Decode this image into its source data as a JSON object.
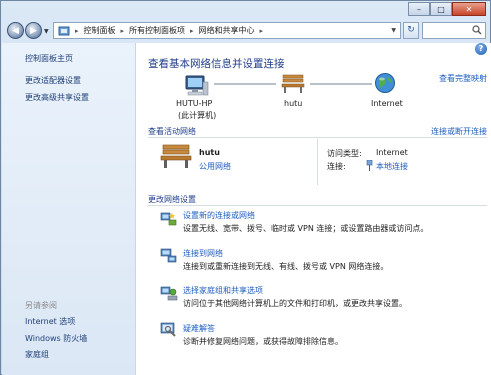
{
  "address_bar": {
    "crumbs": [
      "控制面板",
      "所有控制面板项",
      "网络和共享中心"
    ]
  },
  "window_controls": {
    "minimize": "–",
    "maximize": "□",
    "close": "✕"
  },
  "sidebar": {
    "home": "控制面板主页",
    "links": [
      "更改适配器设置",
      "更改高级共享设置"
    ],
    "see_also_label": "另请参阅",
    "see_also": [
      "Internet 选项",
      "Windows 防火墙",
      "家庭组"
    ]
  },
  "main": {
    "title": "查看基本网络信息并设置连接",
    "view_full_map": "查看完整映射",
    "map": {
      "computer_name": "HUTU-HP",
      "computer_sub": "(此计算机)",
      "network_name": "hutu",
      "internet_label": "Internet"
    },
    "active_label": "查看活动网络",
    "connect_disconnect": "连接或断开连接",
    "active_network": {
      "name": "hutu",
      "type": "公用网络",
      "access_type_label": "访问类型:",
      "access_type_value": "Internet",
      "connections_label": "连接:",
      "connections_value": "本地连接"
    },
    "change_label": "更改网络设置",
    "tasks": [
      {
        "title": "设置新的连接或网络",
        "desc": "设置无线、宽带、拨号、临时或 VPN 连接；或设置路由器或访问点。"
      },
      {
        "title": "连接到网络",
        "desc": "连接到或重新连接到无线、有线、拨号或 VPN 网络连接。"
      },
      {
        "title": "选择家庭组和共享选项",
        "desc": "访问位于其他网络计算机上的文件和打印机，或更改共享设置。"
      },
      {
        "title": "疑难解答",
        "desc": "诊断并修复网络问题，或获得故障排除信息。"
      }
    ]
  },
  "colors": {
    "link": "#1e5dbd",
    "heading": "#1f3c8a",
    "sidebar_bg": "#dbe7f5"
  }
}
